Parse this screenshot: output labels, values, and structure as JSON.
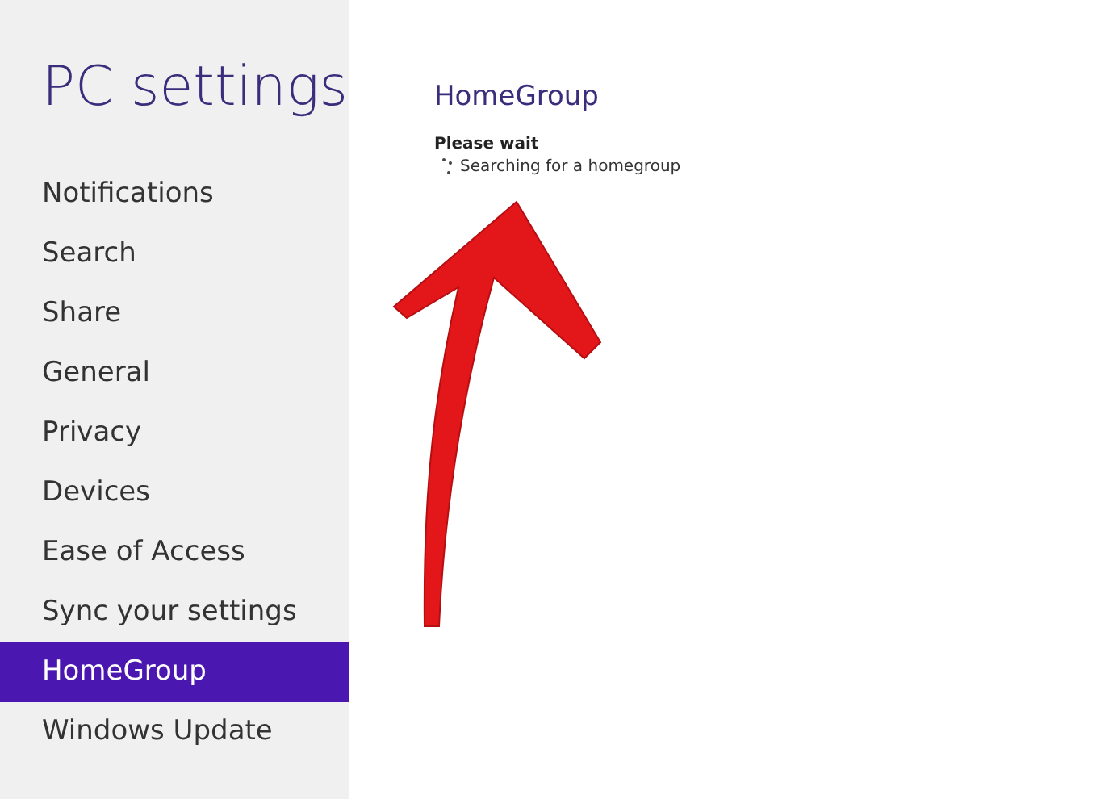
{
  "sidebar": {
    "title": "PC settings",
    "items": [
      {
        "label": "Notifications",
        "selected": false
      },
      {
        "label": "Search",
        "selected": false
      },
      {
        "label": "Share",
        "selected": false
      },
      {
        "label": "General",
        "selected": false
      },
      {
        "label": "Privacy",
        "selected": false
      },
      {
        "label": "Devices",
        "selected": false
      },
      {
        "label": "Ease of Access",
        "selected": false
      },
      {
        "label": "Sync your settings",
        "selected": false
      },
      {
        "label": "HomeGroup",
        "selected": true
      },
      {
        "label": "Windows Update",
        "selected": false
      }
    ]
  },
  "content": {
    "heading": "HomeGroup",
    "status_title": "Please wait",
    "status_text": "Searching for a homegroup"
  }
}
